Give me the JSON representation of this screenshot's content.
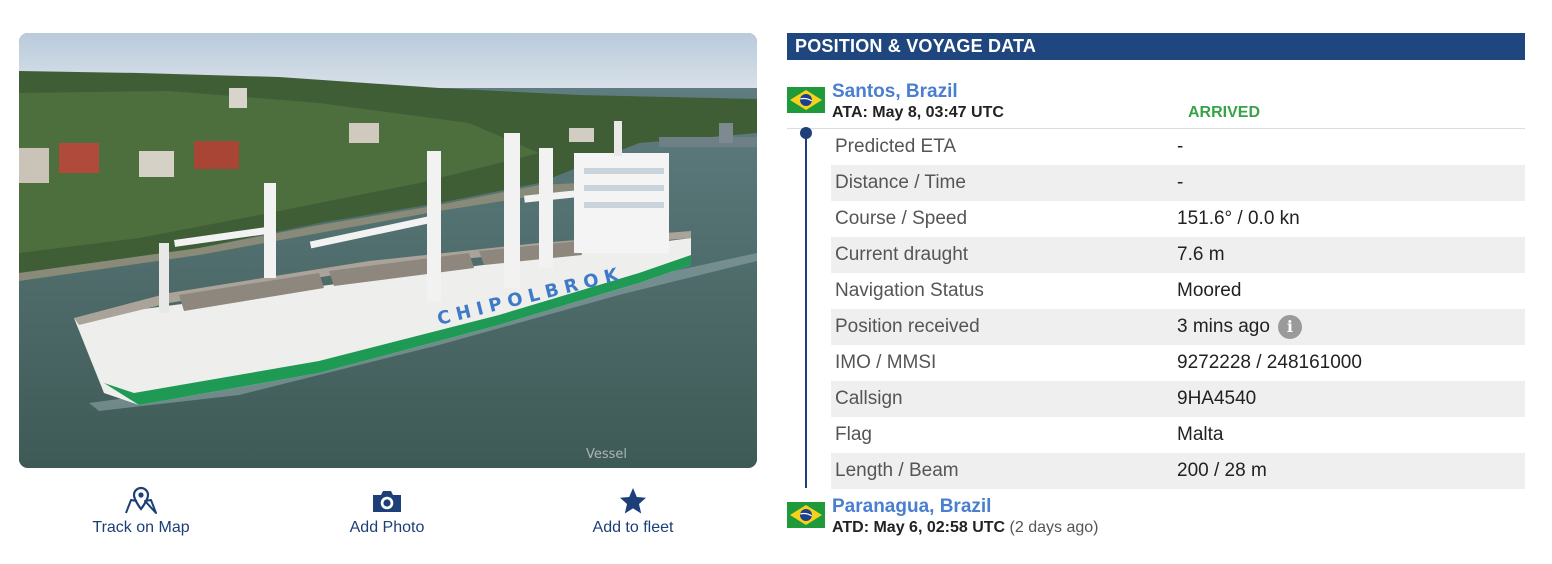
{
  "photo": {
    "watermark": "Vessel"
  },
  "actions": [
    {
      "label": "Track on Map",
      "icon": "map-pin-icon"
    },
    {
      "label": "Add Photo",
      "icon": "camera-icon"
    },
    {
      "label": "Add to fleet",
      "icon": "star-icon"
    }
  ],
  "panel": {
    "title": "POSITION & VOYAGE DATA",
    "origin": {
      "port": "Santos, Brazil",
      "time": "ATA: May 8, 03:47 UTC",
      "status": "ARRIVED",
      "flag": "brazil-flag-icon"
    },
    "rows": [
      {
        "label": "Predicted ETA",
        "value": "-"
      },
      {
        "label": "Distance / Time",
        "value": "-"
      },
      {
        "label": "Course / Speed",
        "value": "151.6° / 0.0 kn"
      },
      {
        "label": "Current draught",
        "value": "7.6 m"
      },
      {
        "label": "Navigation Status",
        "value": "Moored"
      },
      {
        "label": "Position received",
        "value": "3 mins ago"
      },
      {
        "label": "IMO / MMSI",
        "value": "9272228 / 248161000"
      },
      {
        "label": "Callsign",
        "value": "9HA4540"
      },
      {
        "label": "Flag",
        "value": "Malta"
      },
      {
        "label": "Length / Beam",
        "value": "200 / 28 m"
      }
    ],
    "destination": {
      "port": "Paranagua, Brazil",
      "time": "ATD: May 6, 02:58 UTC",
      "ago": "(2 days ago)",
      "flag": "brazil-flag-icon"
    }
  },
  "colors": {
    "header_bg": "#20467f",
    "link": "#4a7fd0",
    "arrived": "#37a347",
    "action": "#1c3f77"
  }
}
